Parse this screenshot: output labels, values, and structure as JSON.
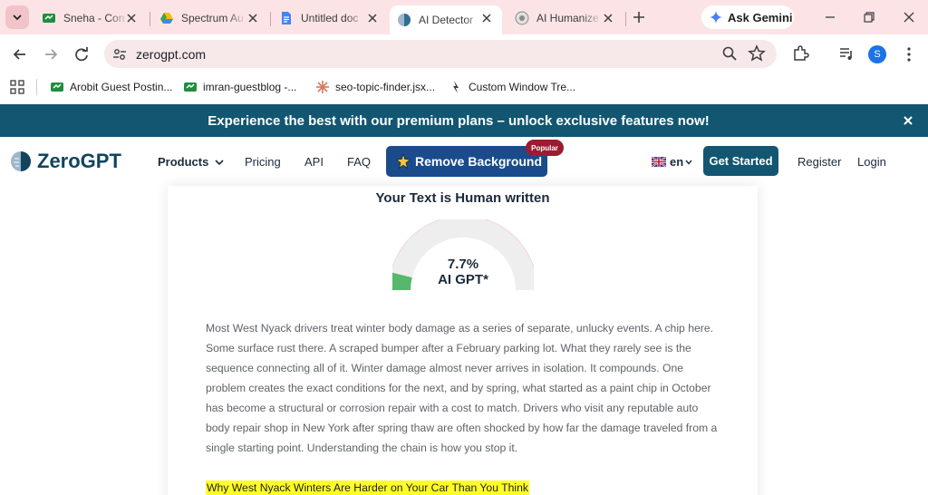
{
  "browser": {
    "tabs": [
      {
        "title": "Sneha - Con",
        "icon": "google-sheets-icon"
      },
      {
        "title": "Spectrum Au",
        "icon": "google-drive-icon"
      },
      {
        "title": "Untitled doc",
        "icon": "google-docs-icon"
      },
      {
        "title": "AI Detector",
        "icon": "zerogpt-icon",
        "active": true
      },
      {
        "title": "AI Humanize",
        "icon": "humanizer-icon"
      }
    ],
    "gemini_label": "Ask Gemini",
    "url": "zerogpt.com",
    "profile_initial": "S",
    "bookmarks": [
      {
        "label": "Arobit Guest Postin...",
        "icon": "google-sheets-icon"
      },
      {
        "label": "imran-guestblog -...",
        "icon": "google-sheets-icon"
      },
      {
        "label": "seo-topic-finder.jsx...",
        "icon": "claude-icon"
      },
      {
        "label": "Custom Window Tre...",
        "icon": "cursor-icon"
      }
    ]
  },
  "promo": {
    "text": "Experience the best with our premium plans – unlock exclusive features now!",
    "color": "#125671"
  },
  "header": {
    "logo": "ZeroGPT",
    "nav": {
      "products": "Products",
      "pricing": "Pricing",
      "api": "API",
      "faq": "FAQ"
    },
    "remove_bg": "Remove Background",
    "popular": "Popular",
    "language": "en",
    "get_started": "Get Started",
    "register": "Register",
    "login": "Login"
  },
  "result": {
    "title": "Your Text is Human written",
    "percent": "7.7%",
    "percent_value": 7.7,
    "label": "AI GPT*",
    "body": "Most West Nyack drivers treat winter body damage as a series of separate, unlucky events. A chip here. Some surface rust there. A scraped bumper after a February parking lot. What they rarely see is the sequence connecting all of it. Winter damage almost never arrives in isolation. It compounds. One problem creates the exact conditions for the next, and by spring, what started as a paint chip in October has become a structural or corrosion repair with a cost to match. Drivers who visit any reputable auto body repair shop in New York after spring thaw are often shocked by how far the damage traveled from a single starting point. Understanding the chain is how you stop it.",
    "highlight": "Why West Nyack Winters Are Harder on Your Car Than You Think"
  }
}
